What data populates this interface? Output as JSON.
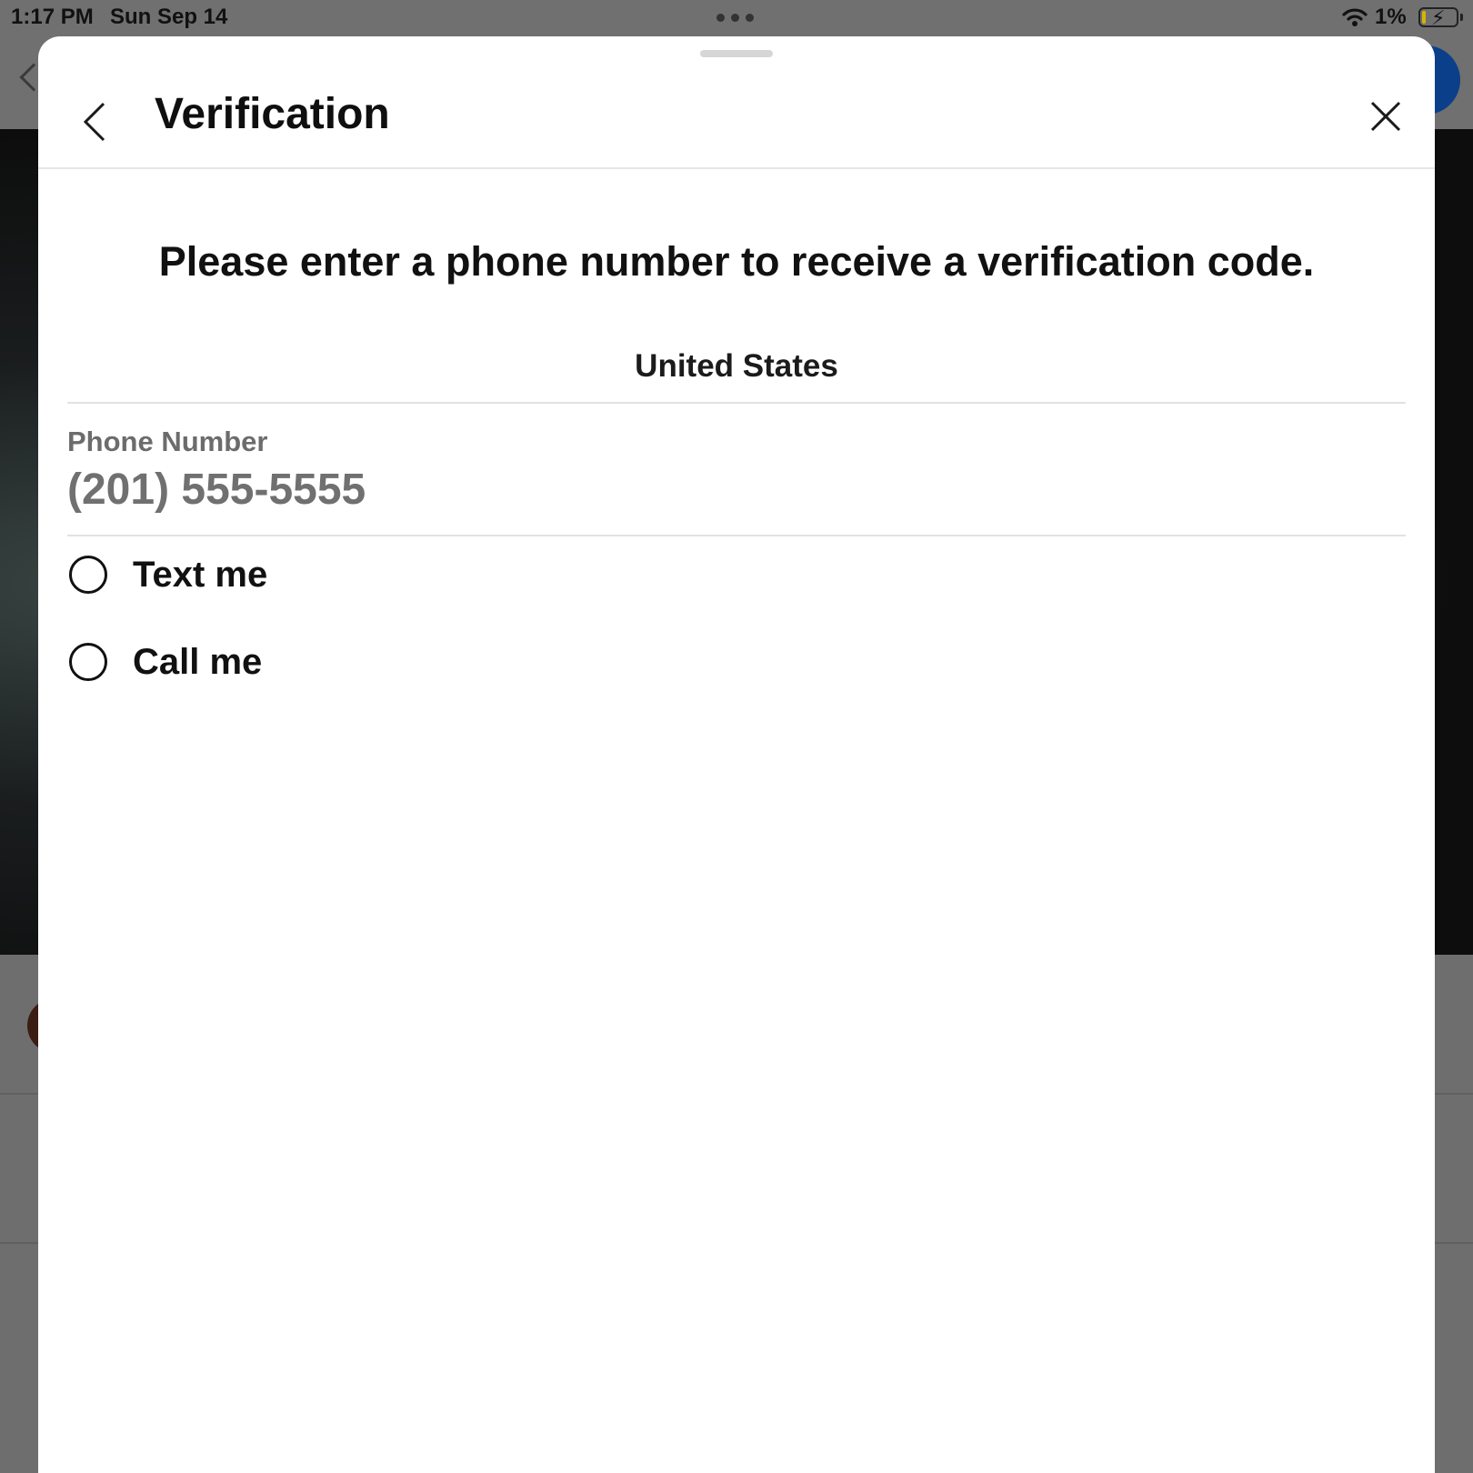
{
  "status_bar": {
    "time": "1:17 PM",
    "date": "Sun Sep 14",
    "battery_percent": "1%",
    "battery_level": 0.01
  },
  "sheet": {
    "title": "Verification",
    "instruction": "Please enter a phone number to receive a verification code.",
    "country": "United States",
    "phone": {
      "label": "Phone Number",
      "value": "",
      "placeholder": "(201) 555-5555"
    },
    "delivery_options": [
      {
        "label": "Text me",
        "selected": false
      },
      {
        "label": "Call me",
        "selected": false
      }
    ]
  },
  "icons": {
    "back": "chevron-left-icon",
    "close": "close-icon",
    "wifi": "wifi-icon",
    "battery": "battery-charging-icon"
  },
  "colors": {
    "sheet_background": "#ffffff",
    "overlay": "#6b6b6b",
    "primary_text": "#111111",
    "secondary_text": "#6c6c6c",
    "divider": "#e2e2e2",
    "accent_background": "#0c3f8a"
  }
}
